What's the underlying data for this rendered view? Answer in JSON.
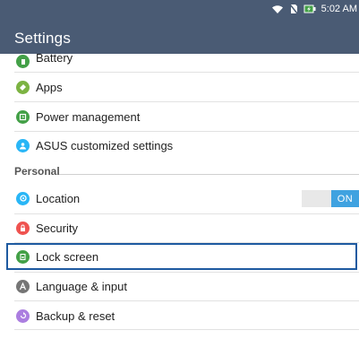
{
  "status_bar": {
    "time": "5:02 AM",
    "icons": [
      "wifi-icon",
      "no-sim-icon",
      "battery-charging-icon"
    ]
  },
  "header": {
    "title": "Settings"
  },
  "items": [
    {
      "label": "Battery",
      "icon": "battery-icon",
      "color": "#43a047"
    },
    {
      "label": "Apps",
      "icon": "apps-icon",
      "color": "#7cb342"
    },
    {
      "label": "Power management",
      "icon": "power-management-icon",
      "color": "#43a047"
    },
    {
      "label": "ASUS customized settings",
      "icon": "asus-settings-icon",
      "color": "#29b6f6"
    }
  ],
  "personal": {
    "header": "Personal",
    "items": [
      {
        "label": "Location",
        "icon": "location-icon",
        "color": "#29b6f6",
        "toggle": "ON"
      },
      {
        "label": "Security",
        "icon": "security-icon",
        "color": "#ef5350"
      },
      {
        "label": "Lock screen",
        "icon": "lock-screen-icon",
        "color": "#43a047",
        "selected": true
      },
      {
        "label": "Language & input",
        "icon": "language-icon",
        "color": "#757575"
      },
      {
        "label": "Backup & reset",
        "icon": "backup-icon",
        "color": "#ab7ee0"
      }
    ]
  }
}
